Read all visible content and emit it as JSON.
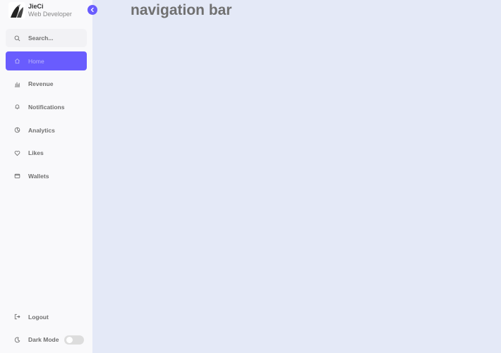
{
  "brand": {
    "name": "JieCi",
    "role": "Web Developer"
  },
  "search": {
    "placeholder": "Search..."
  },
  "menu": [
    {
      "label": "Home",
      "icon": "home-icon",
      "active": true
    },
    {
      "label": "Revenue",
      "icon": "bar-chart-icon",
      "active": false
    },
    {
      "label": "Notifications",
      "icon": "bell-icon",
      "active": false
    },
    {
      "label": "Analytics",
      "icon": "pie-chart-icon",
      "active": false
    },
    {
      "label": "Likes",
      "icon": "heart-icon",
      "active": false
    },
    {
      "label": "Wallets",
      "icon": "wallet-icon",
      "active": false
    }
  ],
  "bottom": {
    "logout_label": "Logout",
    "dark_mode_label": "Dark Mode",
    "dark_mode_on": false
  },
  "main": {
    "title": "navigation bar"
  },
  "colors": {
    "accent": "#695cfe",
    "sidebar_bg": "#f9f9fb",
    "body_bg": "#e4e9f7",
    "text": "#707070"
  }
}
